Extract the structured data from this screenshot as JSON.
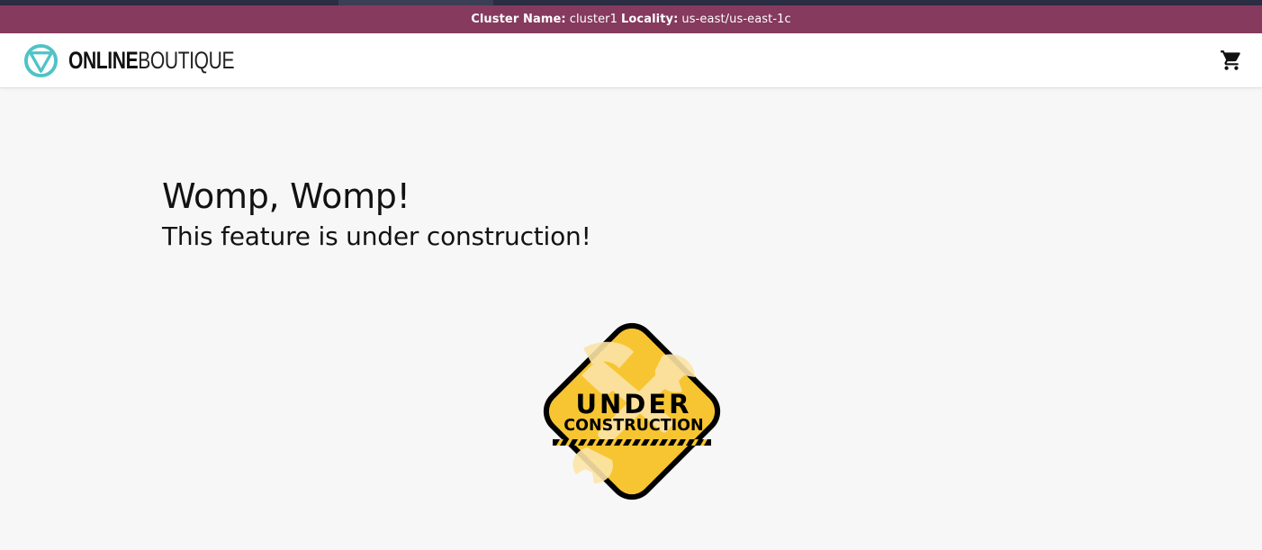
{
  "cluster_bar": {
    "cluster_name_label": "Cluster Name:",
    "cluster_name_value": "cluster1",
    "locality_label": "Locality:",
    "locality_value": "us-east/us-east-1c"
  },
  "header": {
    "logo_strong": "ONLINE",
    "logo_light": "BOUTIQUE",
    "logo_icon": "online-boutique-logo-icon",
    "cart_icon": "shopping-cart-icon"
  },
  "main": {
    "heading": "Womp, Womp!",
    "subheading": "This feature is under construction!"
  },
  "sign": {
    "line1": "UNDER",
    "line2": "CONSTRUCTION",
    "icon": "under-construction-sign"
  },
  "colors": {
    "cluster_bar": "#853a5e",
    "top_strip": "#2b2d42",
    "logo_accent": "#4fc3c7",
    "sign_yellow": "#f7c531",
    "sign_border": "#000000",
    "page_background": "#f7f7f8"
  }
}
